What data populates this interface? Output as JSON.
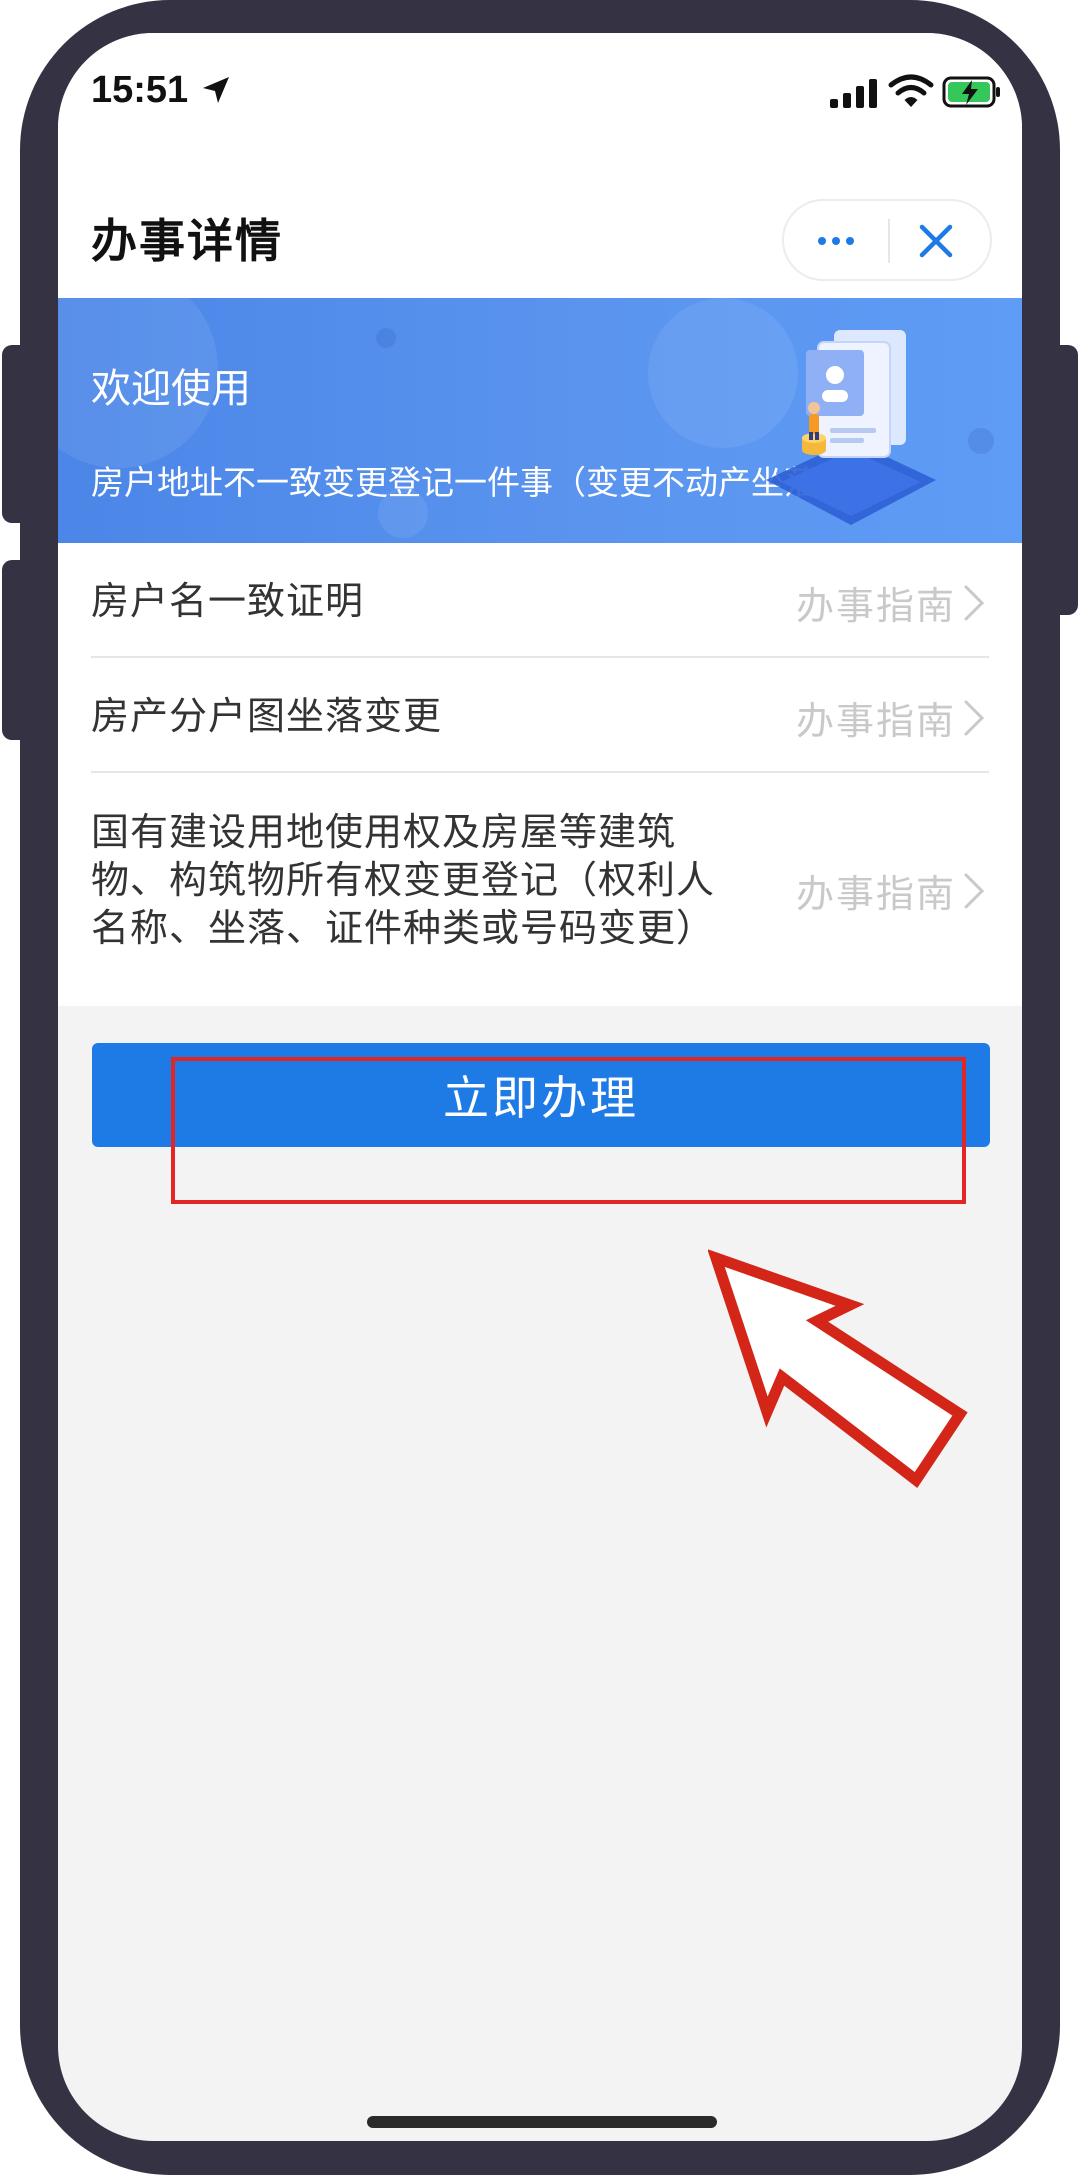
{
  "status_bar": {
    "time": "15:51"
  },
  "header": {
    "title": "办事详情"
  },
  "banner": {
    "title": "欢迎使用",
    "subtitle": "房户地址不一致变更登记一件事（变更不动产坐落地址）"
  },
  "items": [
    {
      "label": "房户名一致证明",
      "link": "办事指南"
    },
    {
      "label": "房产分户图坐落变更",
      "link": "办事指南"
    },
    {
      "label": "国有建设用地使用权及房屋等建筑物、构筑物所有权变更登记（权利人名称、坐落、证件种类或号码变更）",
      "link": "办事指南"
    }
  ],
  "actions": {
    "submit_label": "立即办理"
  },
  "colors": {
    "primary": "#1e7ae4",
    "banner": "#5a94ef",
    "annotation": "#e22626"
  }
}
